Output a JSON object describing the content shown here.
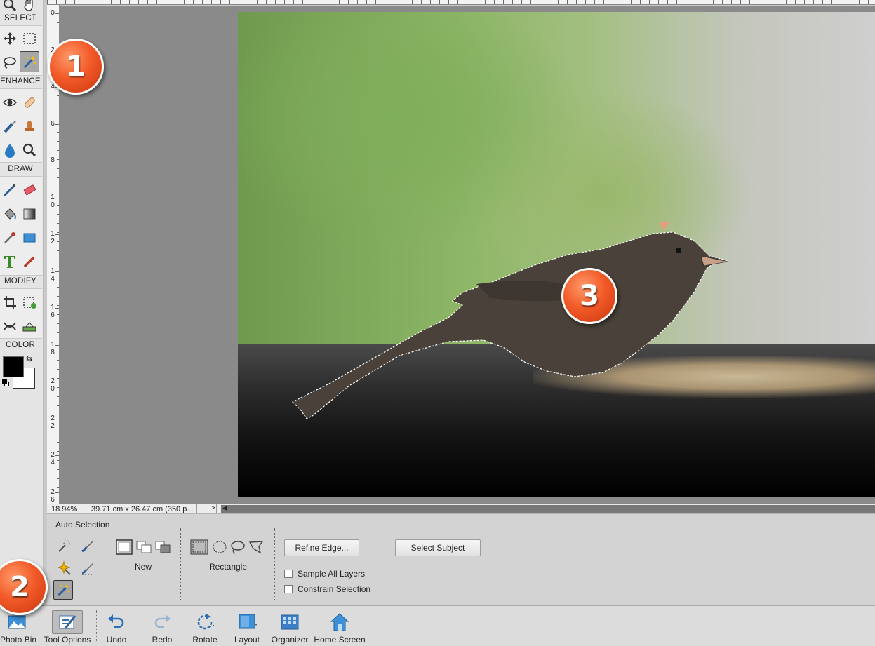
{
  "toolbox": {
    "sections": {
      "select": "SELECT",
      "enhance": "ENHANCE",
      "draw": "DRAW",
      "modify": "MODIFY",
      "color": "COLOR"
    },
    "active_tool": "magic-wand-tool",
    "foreground_color": "#000000",
    "background_color": "#ffffff"
  },
  "ruler": {
    "left_numbers": [
      "0",
      "2",
      "4",
      "6",
      "8",
      "1\n0",
      "1\n2",
      "1\n4",
      "1\n6",
      "1\n8",
      "2\n0",
      "2\n2",
      "2\n4",
      "2\n6"
    ]
  },
  "status": {
    "zoom": "18.94%",
    "doc_size": "39.71 cm x 26.47 cm (350 p...",
    "arrow": ">"
  },
  "options": {
    "title": "Auto Selection",
    "new_label": "New",
    "shape_label": "Rectangle",
    "refine_edge": "Refine Edge...",
    "select_subject": "Select Subject",
    "sample_all_layers": "Sample All Layers",
    "constrain_selection": "Constrain Selection"
  },
  "taskbar": {
    "photo_bin": "Photo Bin",
    "tool_options": "Tool Options",
    "undo": "Undo",
    "redo": "Redo",
    "rotate": "Rotate",
    "layout": "Layout",
    "organizer": "Organizer",
    "home_screen": "Home Screen"
  },
  "callouts": {
    "one": "1",
    "two": "2",
    "three": "3"
  },
  "colors": {
    "accent_callout": "#f25a28",
    "selection_outline": "#ffffff"
  }
}
